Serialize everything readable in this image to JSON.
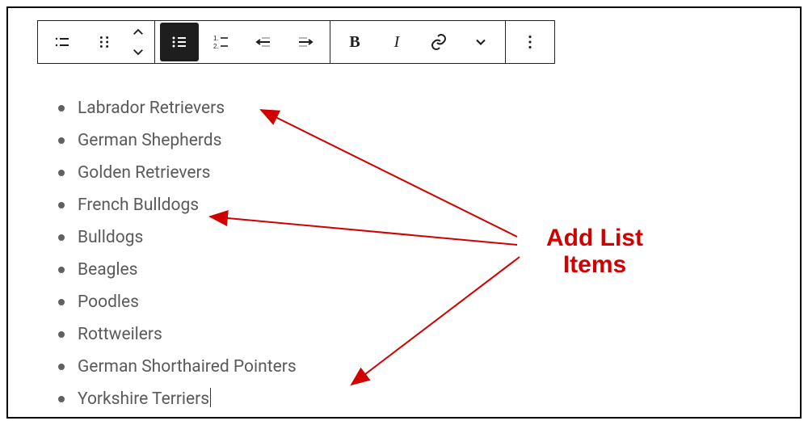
{
  "toolbar": {
    "group1": {
      "list_style": "list-style",
      "drag": "drag-handle",
      "move_up": "move-up",
      "move_down": "move-down"
    },
    "group2": {
      "unordered": "unordered-list",
      "ordered": "ordered-list",
      "outdent": "outdent",
      "indent": "indent"
    },
    "group3": {
      "bold": "B",
      "italic": "I",
      "link": "link",
      "dropdown": "more-formatting"
    },
    "group4": {
      "more": "more-options"
    }
  },
  "list_items": [
    "Labrador Retrievers",
    "German Shepherds",
    "Golden Retrievers",
    "French Bulldogs",
    "Bulldogs",
    "Beagles",
    "Poodles",
    "Rottweilers",
    "German Shorthaired Pointers",
    "Yorkshire Terriers"
  ],
  "annotation": {
    "line1": "Add List",
    "line2": "Items"
  },
  "colors": {
    "annotation": "#d10000",
    "text": "#5a5a5a",
    "toolbar_active": "#1e1e1e"
  }
}
